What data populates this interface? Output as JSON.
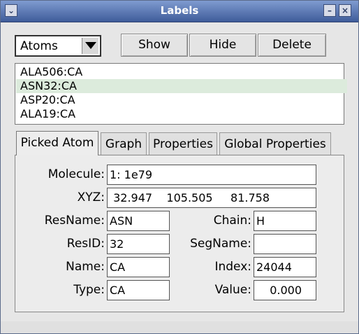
{
  "window": {
    "title": "Labels",
    "menu_icon": "chevron-down-icon",
    "minimize_icon": "minimize-icon",
    "close_icon": "close-icon"
  },
  "controls": {
    "type_select": "Atoms",
    "show_label": "Show",
    "hide_label": "Hide",
    "delete_label": "Delete"
  },
  "atom_list": [
    {
      "label": "ALA506:CA",
      "selected": false
    },
    {
      "label": "ASN32:CA",
      "selected": true
    },
    {
      "label": "ASP20:CA",
      "selected": false
    },
    {
      "label": "ALA19:CA",
      "selected": false
    }
  ],
  "tabs": [
    {
      "label": "Picked Atom",
      "active": true
    },
    {
      "label": "Graph",
      "active": false
    },
    {
      "label": "Properties",
      "active": false
    },
    {
      "label": "Global Properties",
      "active": false
    }
  ],
  "picked_atom": {
    "molecule_label": "Molecule:",
    "molecule_value": "1: 1e79",
    "xyz_label": "XYZ:",
    "xyz_value": " 32.947    105.505     81.758",
    "resname_label": "ResName:",
    "resname_value": "ASN",
    "chain_label": "Chain:",
    "chain_value": "H",
    "resid_label": "ResID:",
    "resid_value": "32",
    "segname_label": "SegName:",
    "segname_value": "",
    "name_label": "Name:",
    "name_value": "CA",
    "index_label": "Index:",
    "index_value": "24044",
    "type_label": "Type:",
    "type_value": "CA",
    "value_label": "Value:",
    "value_value": "0.000"
  }
}
